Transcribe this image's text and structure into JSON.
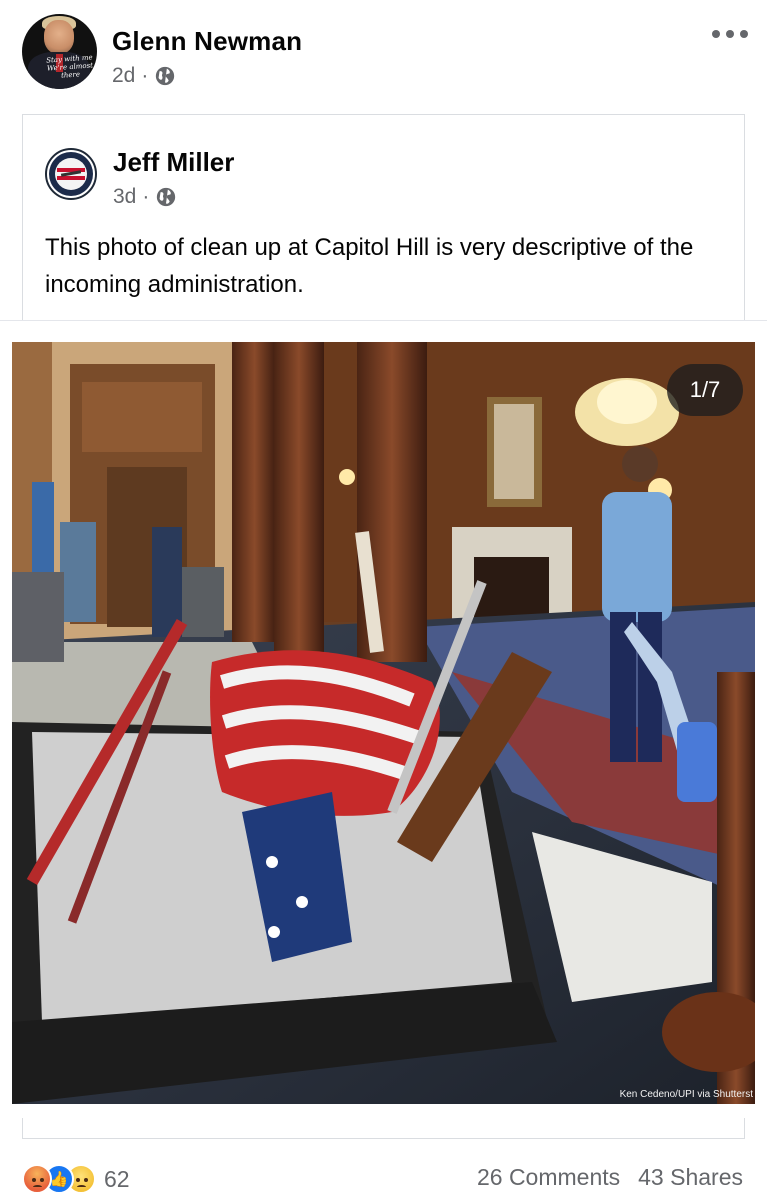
{
  "post": {
    "author": "Glenn Newman",
    "time": "2d",
    "avatar_caption": "Stay with me We're almost there",
    "more_icon": "more-horizontal-icon",
    "privacy_icon": "globe-icon"
  },
  "shared_post": {
    "author": "Jeff Miller",
    "time": "3d",
    "privacy_icon": "globe-icon",
    "text": "This photo of clean up at Capitol Hill is very descriptive of the incoming administration."
  },
  "photo": {
    "counter": "1/7",
    "credit": "Ken Cedeno/UPI via Shutterst"
  },
  "footer": {
    "reactions": [
      "angry-reaction-icon",
      "like-reaction-icon",
      "sad-reaction-icon"
    ],
    "reaction_count": "62",
    "comments": "26 Comments",
    "shares": "43 Shares"
  },
  "colors": {
    "secondary_text": "#65676b",
    "like_blue": "#1877f2",
    "divider": "#dadde1"
  }
}
